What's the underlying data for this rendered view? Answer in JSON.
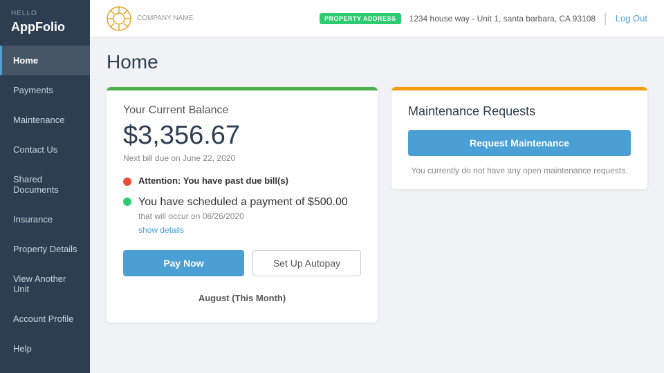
{
  "sidebar": {
    "hello_label": "HELLO",
    "app_name": "AppFolio",
    "items": [
      {
        "id": "home",
        "label": "Home",
        "active": true
      },
      {
        "id": "payments",
        "label": "Payments",
        "active": false
      },
      {
        "id": "maintenance",
        "label": "Maintenance",
        "active": false
      },
      {
        "id": "contact-us",
        "label": "Contact Us",
        "active": false
      },
      {
        "id": "shared-documents",
        "label": "Shared Documents",
        "active": false
      },
      {
        "id": "insurance",
        "label": "Insurance",
        "active": false
      },
      {
        "id": "property-details",
        "label": "Property Details",
        "active": false
      },
      {
        "id": "view-another-unit",
        "label": "View Another Unit",
        "active": false
      },
      {
        "id": "account-profile",
        "label": "Account Profile",
        "active": false
      },
      {
        "id": "help",
        "label": "Help",
        "active": false
      }
    ]
  },
  "header": {
    "company_name": "COMPANY NAME",
    "property_address_badge": "PROPERTY ADDRESS",
    "property_address": "1234 house way - Unit 1, santa barbara, CA 93108",
    "logout_label": "Log Out"
  },
  "page": {
    "title": "Home"
  },
  "balance_card": {
    "title": "Your Current Balance",
    "amount": "$3,356.67",
    "due_date": "Next bill due on June 22, 2020",
    "top_bar_color": "#4caf50",
    "attention_text": "Attention: You have past due bill(s)",
    "scheduled_payment_title": "You have scheduled a payment of $500.00",
    "scheduled_payment_date": "that will occur on 08/26/2020",
    "show_details_label": "show details",
    "pay_now_label": "Pay Now",
    "setup_autopay_label": "Set Up Autopay",
    "month_label": "August (This Month)"
  },
  "maintenance_card": {
    "title": "Maintenance Requests",
    "top_bar_color": "#f39c12",
    "request_btn_label": "Request Maintenance",
    "no_requests_text": "You currently do not have any open maintenance requests."
  }
}
